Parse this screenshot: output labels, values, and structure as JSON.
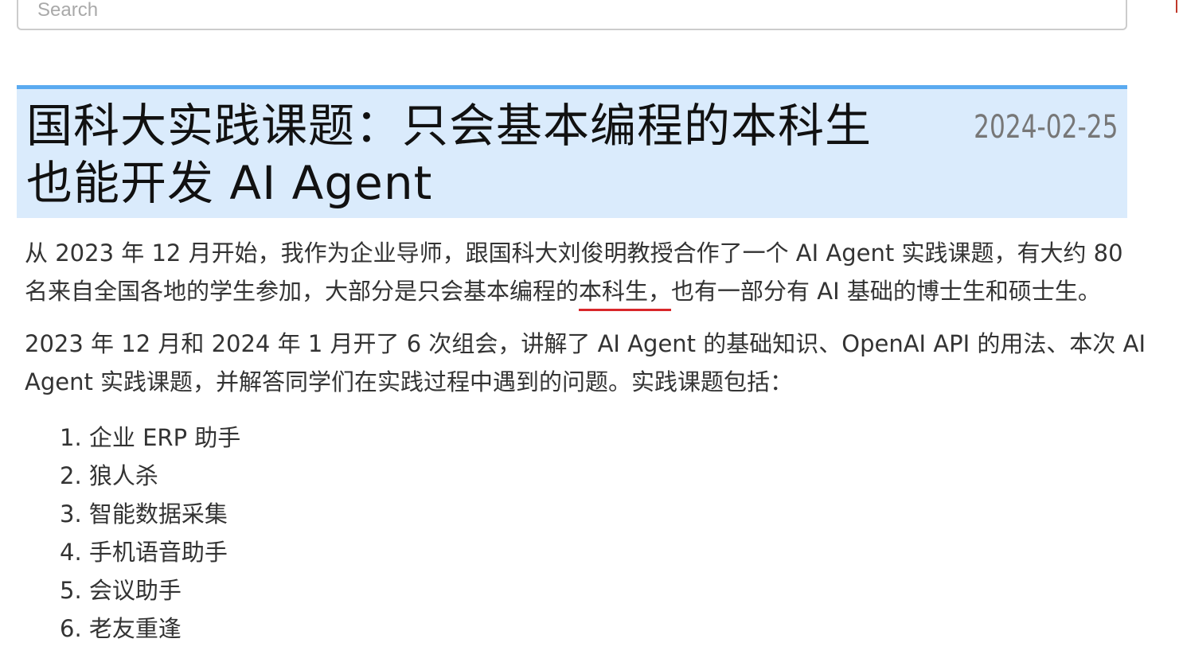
{
  "search": {
    "placeholder": "Search"
  },
  "post": {
    "title": "国科大实践课题：只会基本编程的本科生也能开发 AI Agent",
    "date": "2024-02-25",
    "para1_before": "从 2023 年 12 月开始，我作为企业导师，跟国科大刘俊明教授合作了一个 AI Agent 实践课题，有大约 80 名来自全国各地的学生参加，大部分是只会基本编程的",
    "para1_highlight": "本科生，",
    "para1_after": "也有一部分有 AI 基础的博士生和硕士生。",
    "para2": "2023 年 12 月和 2024 年 1 月开了 6 次组会，讲解了 AI Agent 的基础知识、OpenAI API 的用法、本次 AI Agent 实践课题，并解答同学们在实践过程中遇到的问题。实践课题包括：",
    "topics": [
      "1. 企业 ERP 助手",
      "2. 狼人杀",
      "3. 智能数据采集",
      "4. 手机语音助手",
      "5. 会议助手",
      "6. 老友重逢"
    ]
  },
  "colors": {
    "header_bg": "#daebfc",
    "header_border": "#5aaaf0",
    "underline": "#d9262a"
  }
}
